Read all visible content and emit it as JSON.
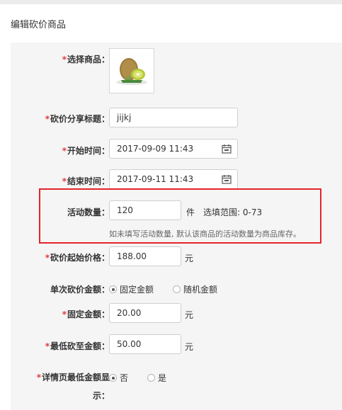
{
  "page": {
    "title": "编辑砍价商品"
  },
  "form": {
    "product": {
      "label": "选择商品：",
      "required": true,
      "image_icon": "kiwi-fruit-image"
    },
    "share_title": {
      "label": "砍价分享标题：",
      "required": true,
      "value": "jijkj"
    },
    "start_time": {
      "label": "开始时间：",
      "required": true,
      "value": "2017-09-09 11:43",
      "icon": "calendar-icon"
    },
    "end_time": {
      "label": "结束时间：",
      "required": true,
      "value": "2017-09-11 11:43",
      "icon": "calendar-icon"
    },
    "quantity": {
      "label": "活动数量：",
      "value": "120",
      "unit": "件",
      "range": "选填范围: 0-73",
      "hint": "如未填写活动数量, 默认该商品的活动数量为商品库存。"
    },
    "start_price": {
      "label": "砍价起始价格：",
      "required": true,
      "value": "188.00",
      "unit": "元"
    },
    "cut_mode": {
      "label": "单次砍价金额：",
      "options": [
        "固定金额",
        "随机金额"
      ],
      "selected": "固定金额"
    },
    "fixed_amount": {
      "label": "固定金额：",
      "required": true,
      "value": "20.00",
      "unit": "元"
    },
    "min_amount": {
      "label": "最低砍至金额：",
      "required": true,
      "value": "50.00",
      "unit": "元"
    },
    "show_min": {
      "label_line1": "详情页最低金额显",
      "label_line2": "示：",
      "required": true,
      "options": [
        "否",
        "是"
      ],
      "selected": "否"
    }
  },
  "colors": {
    "required": "#e4393c",
    "highlight_border": "#e4242b",
    "panel_bg": "#f5f5f5"
  }
}
